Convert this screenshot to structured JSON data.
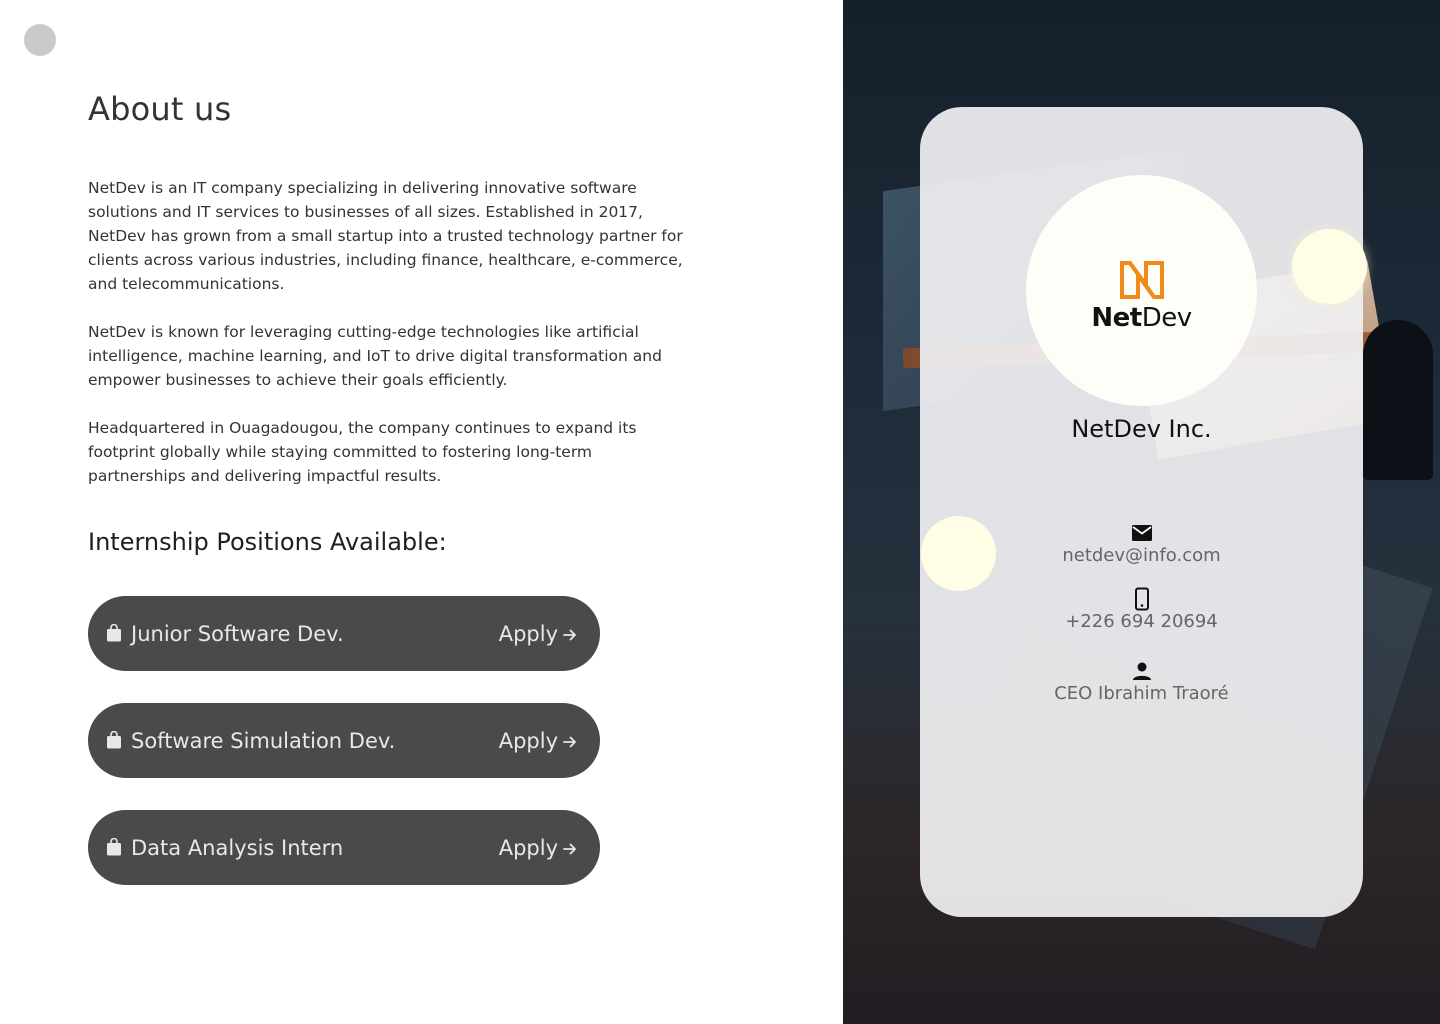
{
  "about": {
    "title": "About us",
    "paragraphs": [
      "NetDev is an IT company specializing in delivering innovative software solutions and IT services to businesses of all sizes. Established in 2017, NetDev has grown from a small startup into a trusted technology partner for clients across various industries, including finance, healthcare, e-commerce, and telecommunications.",
      "NetDev is known for leveraging cutting-edge technologies like artificial intelligence, machine learning, and IoT to drive digital transformation and empower businesses to achieve their goals efficiently.",
      "Headquartered in Ouagadougou, the company continues to expand its footprint globally while staying committed to fostering long-term partnerships and delivering impactful results."
    ]
  },
  "positions": {
    "title": "Internship Positions Available:",
    "items": [
      {
        "title": "Junior Software Dev.",
        "action": "Apply",
        "icon": "shopping-bag-icon"
      },
      {
        "title": "Software Simulation Dev.",
        "action": "Apply",
        "icon": "shopping-bag-icon"
      },
      {
        "title": "Data Analysis Intern",
        "action": "Apply",
        "icon": "shopping-bag-icon"
      }
    ]
  },
  "card": {
    "logo": {
      "bold": "Net",
      "light": "Dev",
      "icon": "netdev-logo-icon"
    },
    "company_name": "NetDev Inc.",
    "email": {
      "icon": "mail-icon",
      "value": "netdev@info.com"
    },
    "phone": {
      "icon": "phone-icon",
      "value": "+226 694 20694"
    },
    "ceo": {
      "icon": "person-icon",
      "value": "CEO Ibrahim Traoré"
    }
  },
  "colors": {
    "button_bg": "#4a4a4a",
    "brand_orange": "#f08a1c",
    "right_panel_bg": "#1b2733"
  }
}
